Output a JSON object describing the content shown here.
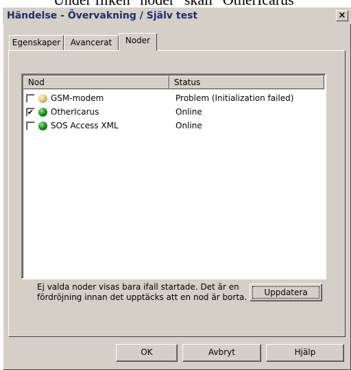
{
  "page_top": {
    "partial_text": "Under fliken \"noder\" skall \"OtherIcarus\""
  },
  "window": {
    "title": "Händelse - Övervakning / Själv test",
    "close_label": "×"
  },
  "tabs": [
    {
      "label": "Egenskaper",
      "active": false
    },
    {
      "label": "Avancerat",
      "active": false
    },
    {
      "label": "Noder",
      "active": true
    }
  ],
  "node_list": {
    "columns": [
      "Nod",
      "Status"
    ],
    "rows": [
      {
        "checked": false,
        "icon": "yellow-status-dot-icon",
        "icon_color": "#c8b060",
        "name": "GSM-modem",
        "status": "Problem (Initialization failed)"
      },
      {
        "checked": true,
        "icon": "green-status-dot-icon",
        "icon_color": "#007a00",
        "name": "OtherIcarus",
        "status": "Online"
      },
      {
        "checked": false,
        "icon": "green-status-dot-icon",
        "icon_color": "#007a00",
        "name": "SOS Access XML",
        "status": "Online"
      }
    ]
  },
  "note": "Ej valda noder visas bara ifall startade. Det är en fördröjning innan det upptäcks att en nod är borta.",
  "buttons": {
    "refresh": "Uppdatera",
    "ok": "OK",
    "cancel": "Avbryt",
    "help": "Hjälp"
  },
  "colors": {
    "dialog_face": "#d4d0c8",
    "title_text": "#1c2f6e",
    "checkmark": "✔"
  }
}
